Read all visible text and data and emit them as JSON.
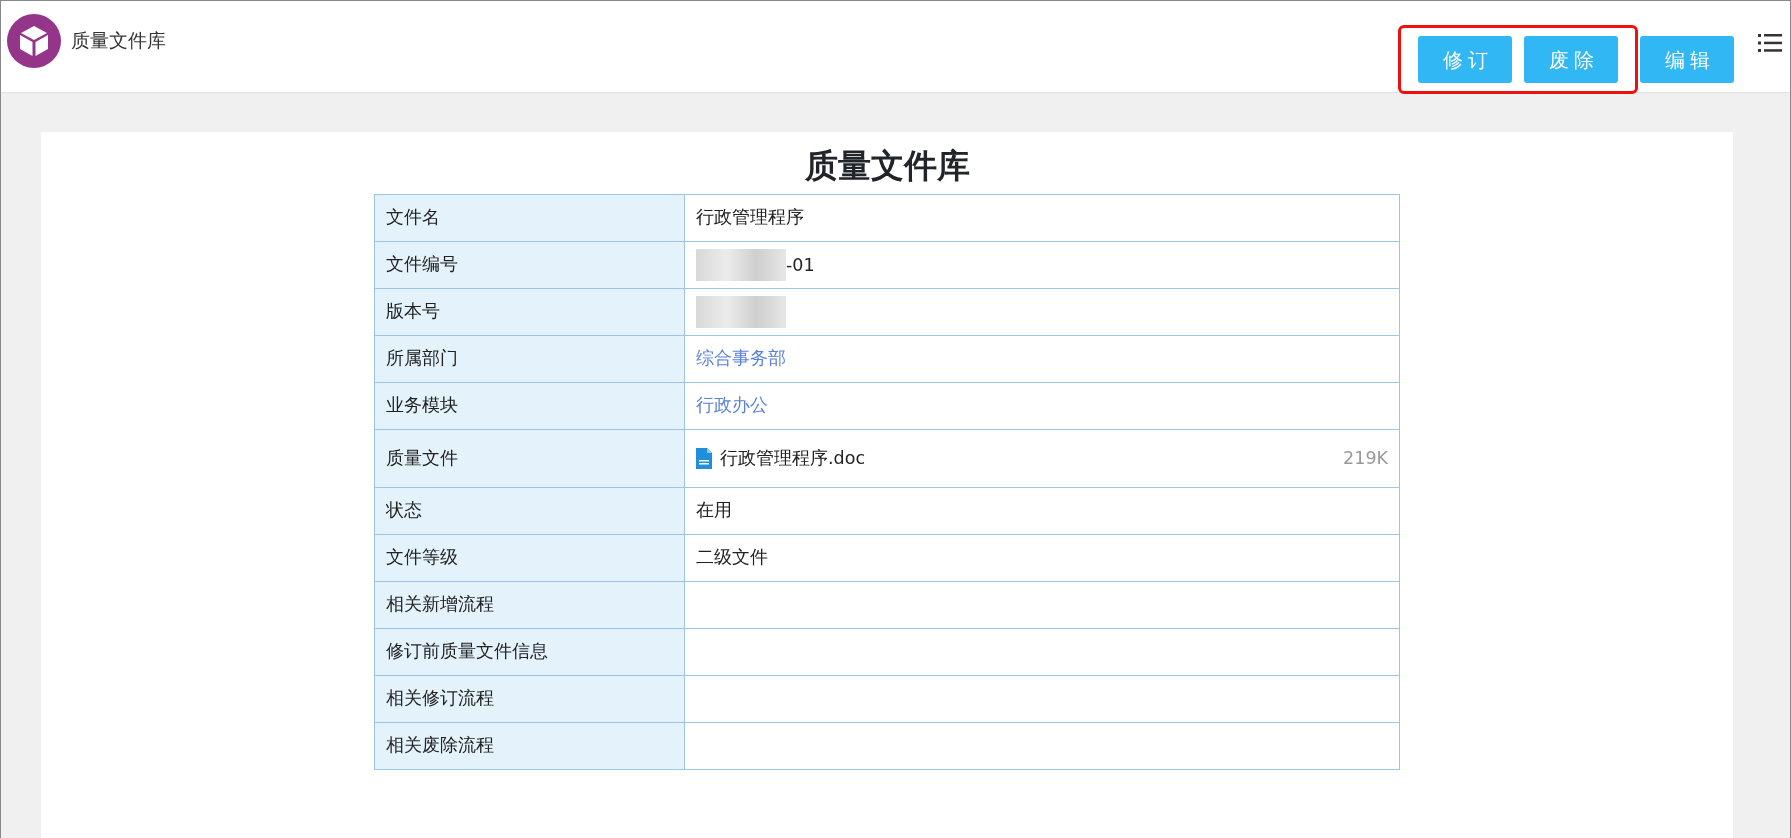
{
  "header": {
    "app_title": "质量文件库"
  },
  "toolbar": [
    {
      "label": "修订",
      "highlighted": true
    },
    {
      "label": "废除",
      "highlighted": true
    },
    {
      "label": "编辑",
      "highlighted": false
    }
  ],
  "document": {
    "title": "质量文件库",
    "rows": [
      {
        "label": "文件名",
        "kind": "text",
        "value": "行政管理程序"
      },
      {
        "label": "文件编号",
        "kind": "redacted",
        "value": "-01"
      },
      {
        "label": "版本号",
        "kind": "redacted"
      },
      {
        "label": "所属部门",
        "kind": "link",
        "value": "综合事务部"
      },
      {
        "label": "业务模块",
        "kind": "link",
        "value": "行政办公"
      },
      {
        "label": "质量文件",
        "kind": "file",
        "value": "行政管理程序.doc",
        "size": "219K"
      },
      {
        "label": "状态",
        "kind": "text",
        "value": "在用"
      },
      {
        "label": "文件等级",
        "kind": "text",
        "value": "二级文件"
      },
      {
        "label": "相关新增流程",
        "kind": "text"
      },
      {
        "label": "修订前质量文件信息",
        "kind": "text"
      },
      {
        "label": "相关修订流程",
        "kind": "text"
      },
      {
        "label": "相关废除流程",
        "kind": "text"
      }
    ]
  }
}
